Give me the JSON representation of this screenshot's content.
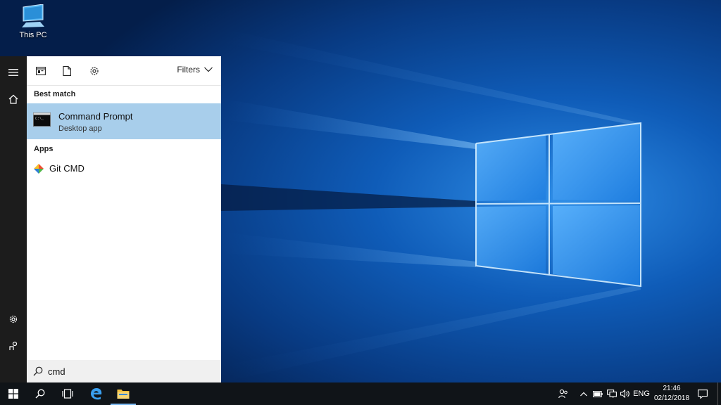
{
  "desktop": {
    "icons": [
      {
        "label": "This PC",
        "icon": "this-pc-icon"
      }
    ]
  },
  "start_rail": {
    "items": [
      {
        "name": "menu",
        "icon": "hamburger-icon"
      },
      {
        "name": "home",
        "icon": "home-icon"
      },
      {
        "name": "settings",
        "icon": "gear-icon"
      },
      {
        "name": "feedback",
        "icon": "feedback-icon"
      }
    ]
  },
  "search_panel": {
    "toolbar": {
      "apps_icon": "apps-filter-icon",
      "documents_icon": "document-icon",
      "settings_icon": "gear-icon",
      "filters_label": "Filters"
    },
    "best_match": {
      "heading": "Best match",
      "title": "Command Prompt",
      "subtitle": "Desktop app",
      "icon": "command-prompt-icon"
    },
    "apps": {
      "heading": "Apps",
      "items": [
        {
          "label": "Git CMD",
          "icon": "git-icon"
        }
      ]
    },
    "search": {
      "value": "cmd",
      "icon": "search-icon"
    }
  },
  "taskbar": {
    "start_icon": "windows-logo-icon",
    "search_icon": "search-icon",
    "taskview_icon": "task-view-icon",
    "pinned": [
      {
        "name": "edge",
        "icon": "edge-icon"
      },
      {
        "name": "file-explorer",
        "icon": "folder-icon"
      }
    ],
    "tray": {
      "language": "ENG",
      "time": "21:46",
      "date": "02/12/2018"
    }
  },
  "colors": {
    "selection": "#a8ceeb",
    "rail": "#1c1c1c",
    "taskbar": "#101418",
    "accent": "#0078d7"
  }
}
